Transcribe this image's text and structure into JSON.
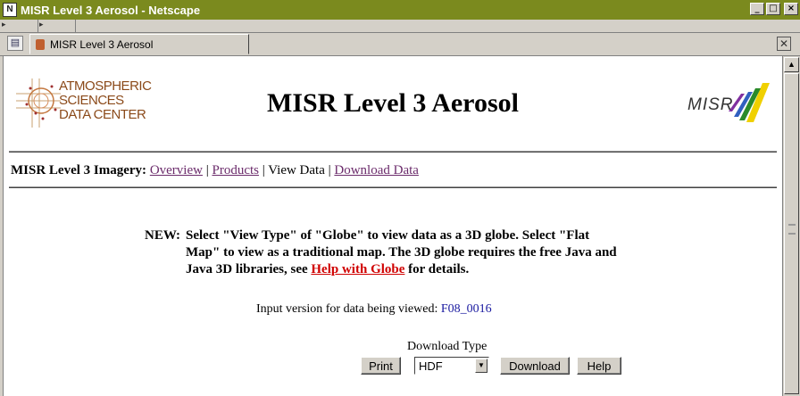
{
  "window": {
    "title": "MISR Level 3 Aerosol - Netscape",
    "minimize_glyph": "_",
    "maximize_glyph": "□",
    "close_glyph": "×"
  },
  "tabs": [
    {
      "label": "MISR Level 3 Aerosol"
    }
  ],
  "header": {
    "left_logo_lines": [
      "ATMOSPHERIC",
      "SCIENCES",
      "DATA CENTER"
    ],
    "title": "MISR Level 3 Aerosol",
    "right_logo_text": "MISR"
  },
  "nav": {
    "prefix": "MISR Level 3 Imagery:",
    "items": [
      {
        "label": "Overview",
        "link": true
      },
      {
        "label": "Products",
        "link": true
      },
      {
        "label": "View Data",
        "link": false
      },
      {
        "label": "Download Data",
        "link": true
      }
    ],
    "separator": " | "
  },
  "notice": {
    "label": "NEW:",
    "text_before": "Select \"View Type\" of \"Globe\" to view data as a 3D globe. Select \"Flat Map\" to view as a traditional map. The 3D globe requires the free Java and Java 3D libraries, see ",
    "link_text": "Help with Globe",
    "text_after": " for details."
  },
  "version": {
    "label": "Input version for data being viewed:",
    "value": "F08_0016"
  },
  "download": {
    "type_label": "Download Type",
    "print_label": "Print",
    "selected": "HDF",
    "download_label": "Download",
    "help_label": "Help"
  },
  "colors": {
    "titlebar": "#7b8a1e",
    "link_visited": "#6b2b6b",
    "link_red": "#d00000",
    "version_value": "#1a1aa0"
  }
}
